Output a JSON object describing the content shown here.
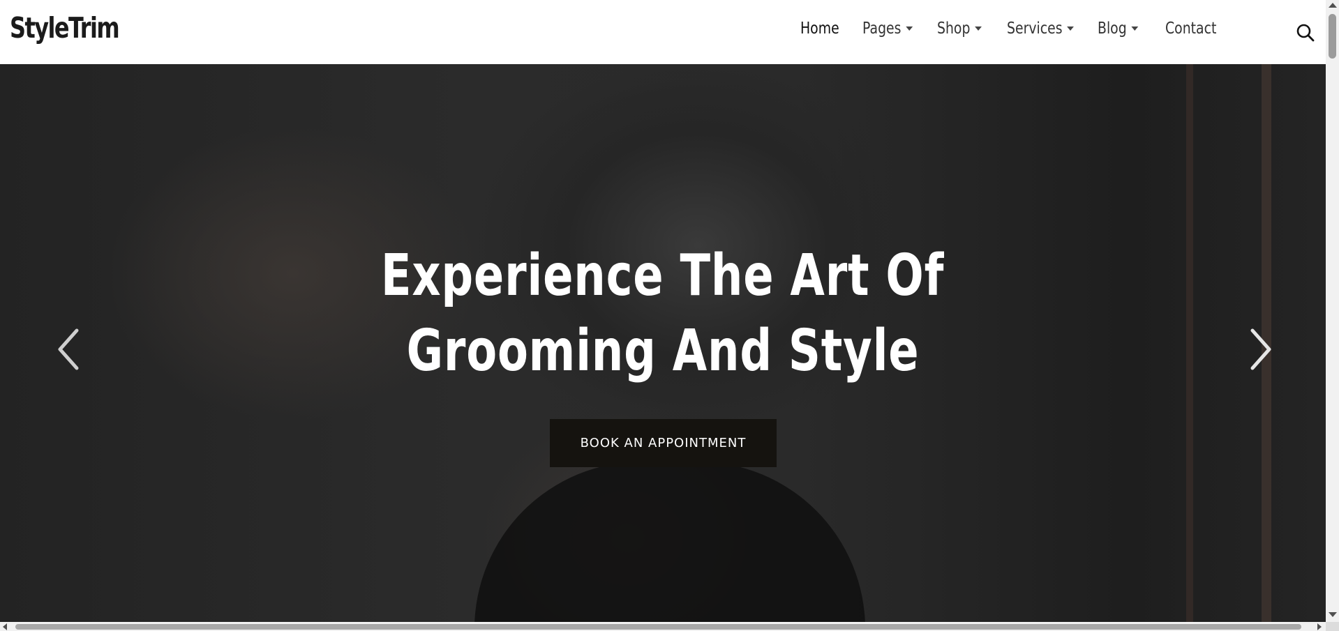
{
  "brand": {
    "logo_text": "StyleTrim"
  },
  "nav": {
    "items": [
      {
        "label": "Home",
        "dropdown": false,
        "active": true
      },
      {
        "label": "Pages",
        "dropdown": true
      },
      {
        "label": "Shop",
        "dropdown": true
      },
      {
        "label": "Services",
        "dropdown": true
      },
      {
        "label": "Blog",
        "dropdown": true
      },
      {
        "label": "Contact",
        "dropdown": false
      }
    ],
    "search_icon": "search-icon"
  },
  "hero": {
    "title_line1": "Experience The Art Of",
    "title_line2": "Grooming And Style",
    "cta_label": "BOOK AN APPOINTMENT",
    "prev_icon": "chevron-left-icon",
    "next_icon": "chevron-right-icon"
  },
  "colors": {
    "header_bg": "#ffffff",
    "hero_overlay": "#262626",
    "cta_bg": "#15130f",
    "text_light": "#ffffff",
    "text_dark": "#1b1b1b"
  }
}
